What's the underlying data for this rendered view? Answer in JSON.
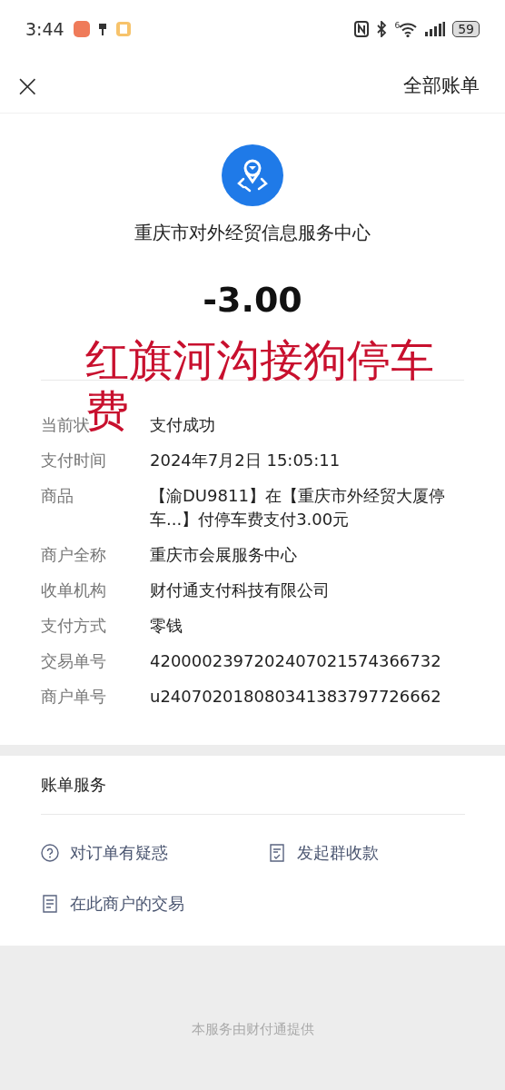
{
  "status_bar": {
    "time": "3:44",
    "wifi_badge": "6",
    "battery": "59"
  },
  "header": {
    "close": "×",
    "action": "全部账单"
  },
  "merchant": {
    "name": "重庆市对外经贸信息服务中心",
    "amount": "-3.00"
  },
  "annotation": [
    "红旗河沟接狗停车",
    "费"
  ],
  "details": [
    {
      "label": "当前状",
      "value": "支付成功"
    },
    {
      "label": "支付时间",
      "value": "2024年7月2日 15:05:11"
    },
    {
      "label": "商品",
      "value": "【渝DU9811】在【重庆市外经贸大厦停车...】付停车费支付3.00元"
    },
    {
      "label": "商户全称",
      "value": "重庆市会展服务中心"
    },
    {
      "label": "收单机构",
      "value": "财付通支付科技有限公司"
    },
    {
      "label": "支付方式",
      "value": "零钱"
    },
    {
      "label": "交易单号",
      "value": "4200002397202407021574366732"
    },
    {
      "label": "商户单号",
      "value": "u240702018080341383797726662"
    }
  ],
  "services": {
    "title": "账单服务",
    "items": [
      {
        "kind": "question",
        "label": "对订单有疑惑"
      },
      {
        "kind": "receipt",
        "label": "发起群收款"
      },
      {
        "kind": "document",
        "label": "在此商户的交易"
      }
    ]
  },
  "footer": "本服务由财付通提供"
}
